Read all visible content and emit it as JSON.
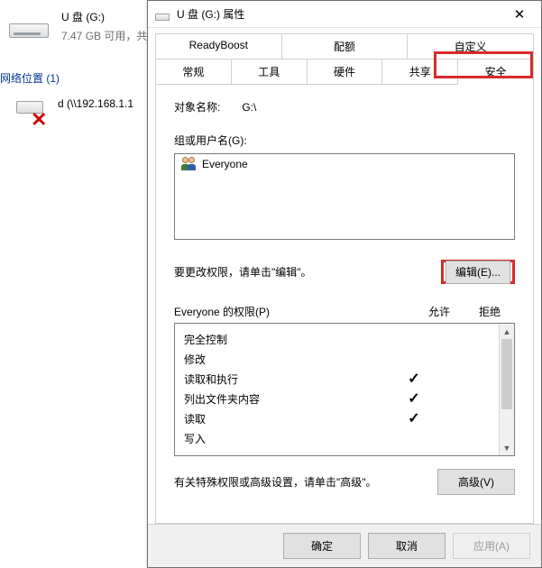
{
  "explorer": {
    "drive": {
      "title": "U 盘 (G:)",
      "sub": "7.47 GB 可用，共"
    },
    "sectionHeader": "网络位置 (1)",
    "net": {
      "title": "d (\\\\192.168.1.1"
    }
  },
  "dialog": {
    "title": "U 盘 (G:) 属性",
    "closeGlyph": "✕",
    "tabsTop": [
      "ReadyBoost",
      "配额",
      "自定义"
    ],
    "tabsBottom": [
      "常规",
      "工具",
      "硬件",
      "共享",
      "安全"
    ],
    "activeTab": "安全",
    "objectLabel": "对象名称:",
    "objectValue": "G:\\",
    "usersLabel": "组或用户名(G):",
    "users": [
      {
        "name": "Everyone"
      }
    ],
    "editText": "要更改权限，请单击\"编辑\"。",
    "editBtn": "编辑(E)...",
    "permHeader": {
      "name": "Everyone 的权限(P)",
      "allow": "允许",
      "deny": "拒绝"
    },
    "perms": [
      {
        "label": "完全控制",
        "allow": false,
        "deny": false
      },
      {
        "label": "修改",
        "allow": false,
        "deny": false
      },
      {
        "label": "读取和执行",
        "allow": true,
        "deny": false
      },
      {
        "label": "列出文件夹内容",
        "allow": true,
        "deny": false
      },
      {
        "label": "读取",
        "allow": true,
        "deny": false
      },
      {
        "label": "写入",
        "allow": false,
        "deny": false
      }
    ],
    "checkGlyph": "✓",
    "advText": "有关特殊权限或高级设置，请单击\"高级\"。",
    "advBtn": "高级(V)",
    "footer": {
      "ok": "确定",
      "cancel": "取消",
      "apply": "应用(A)"
    }
  }
}
